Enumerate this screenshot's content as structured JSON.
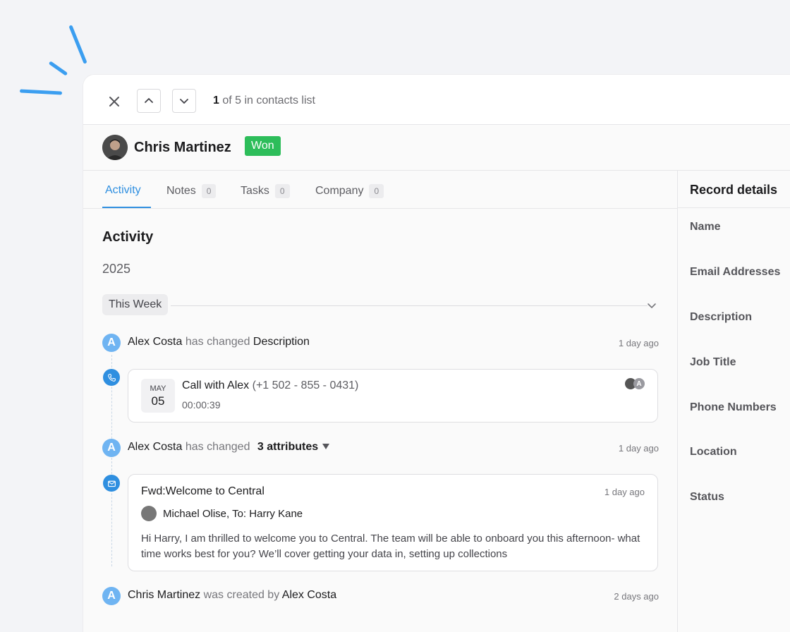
{
  "nav": {
    "pager_current": "1",
    "pager_rest": "of 5 in contacts list"
  },
  "contact": {
    "name": "Chris Martinez",
    "status_badge": "Won"
  },
  "tabs": [
    {
      "label": "Activity",
      "count": ""
    },
    {
      "label": "Notes",
      "count": "0"
    },
    {
      "label": "Tasks",
      "count": "0"
    },
    {
      "label": "Company",
      "count": "0"
    }
  ],
  "activity": {
    "heading": "Activity",
    "year": "2025",
    "period": "This Week",
    "item1": {
      "avatar": "A",
      "actor": "Alex Costa",
      "verb": "has changed",
      "object": "Description",
      "time": "1 day ago"
    },
    "call": {
      "month": "MAY",
      "day": "05",
      "title": "Call with Alex",
      "phone": "(+1 502 - 855 - 0431)",
      "duration": "00:00:39",
      "avatar_letter": "A"
    },
    "item2": {
      "avatar": "A",
      "actor": "Alex Costa",
      "verb": "has changed",
      "object": "3 attributes",
      "time": "1 day ago"
    },
    "email": {
      "subject": "Fwd:Welcome to Central",
      "time": "1 day ago",
      "from_to": "Michael Olise, To: Harry Kane",
      "body": "Hi Harry, I am thrilled to welcome you to Central. The team will be able to onboard  you this afternoon- what time works best for you? We’ll cover getting your data in, setting up collections"
    },
    "item3": {
      "avatar": "A",
      "actor": "Chris Martinez",
      "verb": "was created by",
      "object": "Alex Costa",
      "time": "2 days ago"
    }
  },
  "record_details": {
    "title": "Record details",
    "fields": [
      "Name",
      "Email Addresses",
      "Description",
      "Job Title",
      "Phone Numbers",
      "Location",
      "Status"
    ]
  },
  "colors": {
    "accent": "#2f8fe0",
    "won": "#2dbd5a"
  }
}
